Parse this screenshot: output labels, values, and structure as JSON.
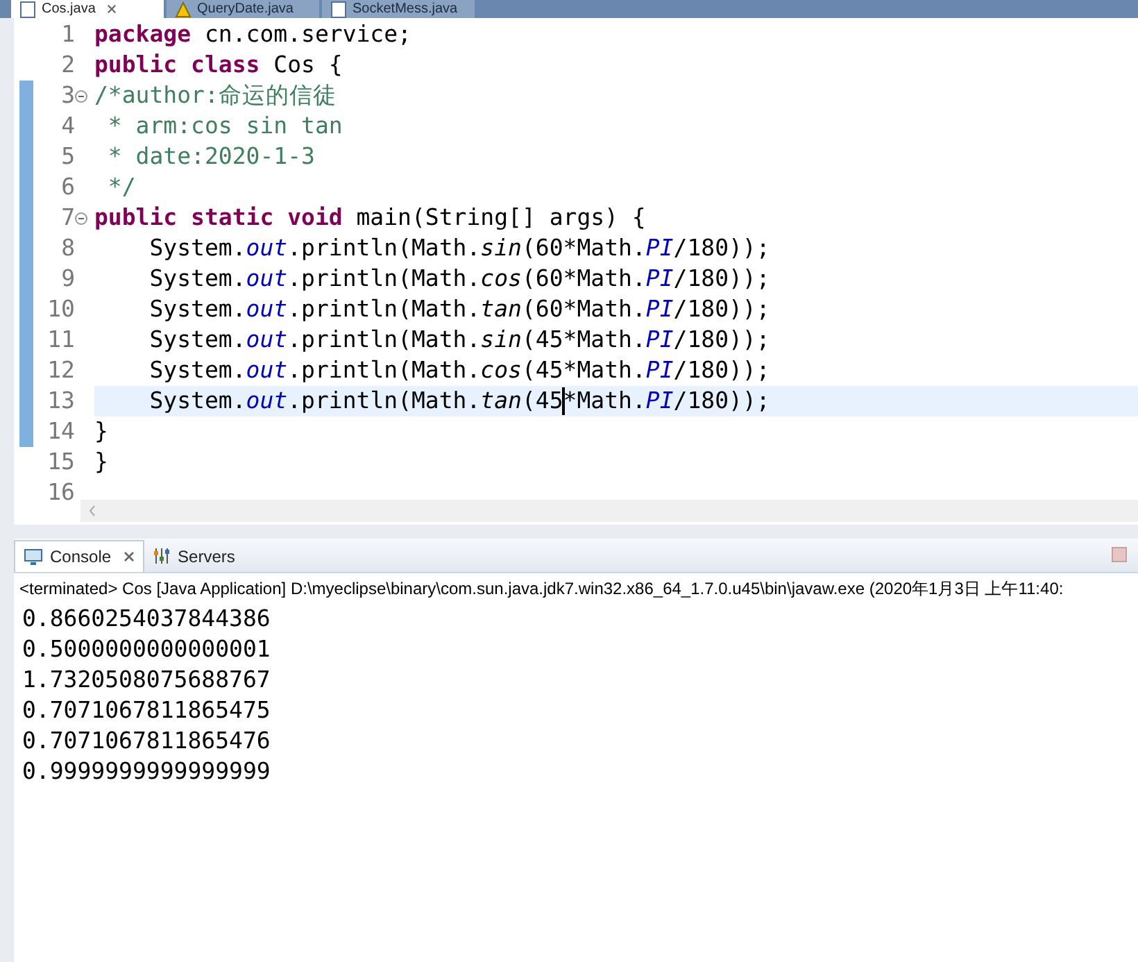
{
  "editor_tabs": [
    {
      "label": "Cos.java",
      "selected": true,
      "kind": "java",
      "closable": true
    },
    {
      "label": "QueryDate.java",
      "selected": false,
      "kind": "warning",
      "closable": false
    },
    {
      "label": "SocketMess.java",
      "selected": false,
      "kind": "java",
      "closable": false
    }
  ],
  "code_lines": [
    {
      "number": "1",
      "fold": false,
      "changed": false,
      "current": false,
      "tokens": [
        {
          "kind": "keyword",
          "text": "package"
        },
        {
          "kind": "plain",
          "text": " cn.com.service;"
        }
      ]
    },
    {
      "number": "2",
      "fold": false,
      "changed": false,
      "current": false,
      "tokens": [
        {
          "kind": "keyword",
          "text": "public class"
        },
        {
          "kind": "plain",
          "text": " Cos {"
        }
      ]
    },
    {
      "number": "3",
      "fold": true,
      "changed": true,
      "current": false,
      "tokens": [
        {
          "kind": "comment",
          "text": "/*author:命运的信徒"
        }
      ]
    },
    {
      "number": "4",
      "fold": false,
      "changed": true,
      "current": false,
      "tokens": [
        {
          "kind": "comment",
          "text": " * arm:cos sin tan"
        }
      ]
    },
    {
      "number": "5",
      "fold": false,
      "changed": true,
      "current": false,
      "tokens": [
        {
          "kind": "comment",
          "text": " * date:2020-1-3"
        }
      ]
    },
    {
      "number": "6",
      "fold": false,
      "changed": true,
      "current": false,
      "tokens": [
        {
          "kind": "comment",
          "text": " */"
        }
      ]
    },
    {
      "number": "7",
      "fold": true,
      "changed": true,
      "current": false,
      "tokens": [
        {
          "kind": "keyword",
          "text": "public static void"
        },
        {
          "kind": "plain",
          "text": " main(String[] args) {"
        }
      ]
    },
    {
      "number": "8",
      "fold": false,
      "changed": true,
      "current": false,
      "tokens": [
        {
          "kind": "plain",
          "text": "    System."
        },
        {
          "kind": "field",
          "text": "out"
        },
        {
          "kind": "plain",
          "text": ".println(Math."
        },
        {
          "kind": "static",
          "text": "sin"
        },
        {
          "kind": "plain",
          "text": "(60*Math."
        },
        {
          "kind": "field",
          "text": "PI"
        },
        {
          "kind": "plain",
          "text": "/180));"
        }
      ]
    },
    {
      "number": "9",
      "fold": false,
      "changed": true,
      "current": false,
      "tokens": [
        {
          "kind": "plain",
          "text": "    System."
        },
        {
          "kind": "field",
          "text": "out"
        },
        {
          "kind": "plain",
          "text": ".println(Math."
        },
        {
          "kind": "static",
          "text": "cos"
        },
        {
          "kind": "plain",
          "text": "(60*Math."
        },
        {
          "kind": "field",
          "text": "PI"
        },
        {
          "kind": "plain",
          "text": "/180));"
        }
      ]
    },
    {
      "number": "10",
      "fold": false,
      "changed": true,
      "current": false,
      "tokens": [
        {
          "kind": "plain",
          "text": "    System."
        },
        {
          "kind": "field",
          "text": "out"
        },
        {
          "kind": "plain",
          "text": ".println(Math."
        },
        {
          "kind": "static",
          "text": "tan"
        },
        {
          "kind": "plain",
          "text": "(60*Math."
        },
        {
          "kind": "field",
          "text": "PI"
        },
        {
          "kind": "plain",
          "text": "/180));"
        }
      ]
    },
    {
      "number": "11",
      "fold": false,
      "changed": true,
      "current": false,
      "tokens": [
        {
          "kind": "plain",
          "text": "    System."
        },
        {
          "kind": "field",
          "text": "out"
        },
        {
          "kind": "plain",
          "text": ".println(Math."
        },
        {
          "kind": "static",
          "text": "sin"
        },
        {
          "kind": "plain",
          "text": "(45*Math."
        },
        {
          "kind": "field",
          "text": "PI"
        },
        {
          "kind": "plain",
          "text": "/180));"
        }
      ]
    },
    {
      "number": "12",
      "fold": false,
      "changed": true,
      "current": false,
      "tokens": [
        {
          "kind": "plain",
          "text": "    System."
        },
        {
          "kind": "field",
          "text": "out"
        },
        {
          "kind": "plain",
          "text": ".println(Math."
        },
        {
          "kind": "static",
          "text": "cos"
        },
        {
          "kind": "plain",
          "text": "(45*Math."
        },
        {
          "kind": "field",
          "text": "PI"
        },
        {
          "kind": "plain",
          "text": "/180));"
        }
      ]
    },
    {
      "number": "13",
      "fold": false,
      "changed": true,
      "current": true,
      "tokens": [
        {
          "kind": "plain",
          "text": "    System."
        },
        {
          "kind": "field",
          "text": "out"
        },
        {
          "kind": "plain",
          "text": ".println(Math."
        },
        {
          "kind": "static",
          "text": "tan"
        },
        {
          "kind": "plain",
          "text": "(45"
        },
        {
          "kind": "caret"
        },
        {
          "kind": "plain",
          "text": "*Math."
        },
        {
          "kind": "field",
          "text": "PI"
        },
        {
          "kind": "plain",
          "text": "/180));"
        }
      ]
    },
    {
      "number": "14",
      "fold": false,
      "changed": true,
      "current": false,
      "tokens": [
        {
          "kind": "plain",
          "text": "}"
        }
      ]
    },
    {
      "number": "15",
      "fold": false,
      "changed": false,
      "current": false,
      "tokens": [
        {
          "kind": "plain",
          "text": "}"
        }
      ]
    },
    {
      "number": "16",
      "fold": false,
      "changed": false,
      "current": false
    }
  ],
  "console": {
    "tabs": [
      {
        "label": "Console",
        "selected": true,
        "kind": "console",
        "closable": true
      },
      {
        "label": "Servers",
        "selected": false,
        "kind": "servers",
        "closable": false
      }
    ],
    "header": "<terminated> Cos [Java Application] D:\\myeclipse\\binary\\com.sun.java.jdk7.win32.x86_64_1.7.0.u45\\bin\\javaw.exe (2020年1月3日 上午11:40:",
    "output": [
      "0.8660254037844386",
      "0.5000000000000001",
      "1.7320508075688767",
      "0.7071067811865475",
      "0.7071067811865476",
      "0.9999999999999999"
    ]
  }
}
